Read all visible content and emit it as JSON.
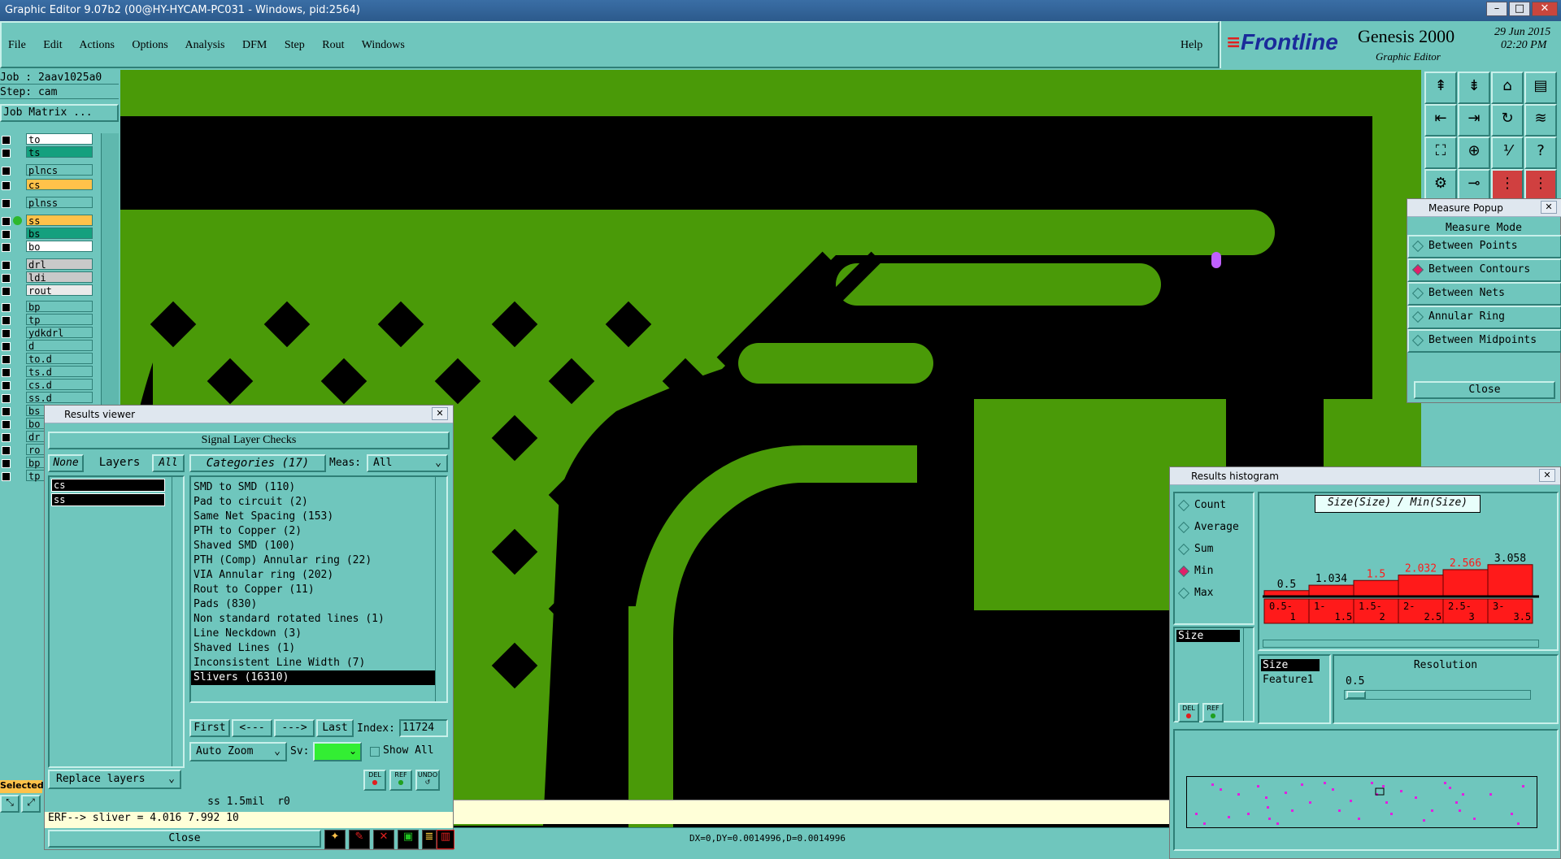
{
  "window": {
    "title": "Graphic Editor 9.07b2 (00@HY-HYCAM-PC031 - Windows, pid:2564)"
  },
  "menu": [
    "File",
    "Edit",
    "Actions",
    "Options",
    "Analysis",
    "DFM",
    "Step",
    "Rout",
    "Windows"
  ],
  "help": "Help",
  "brand": {
    "logo": "Frontline",
    "product": "Genesis 2000",
    "subtitle": "Graphic Editor",
    "date": "29 Jun 2015",
    "time": "02:20 PM"
  },
  "job": {
    "job_label": "Job : 2aav1025a0",
    "step_label": "Step: cam",
    "matrix_button": "Job Matrix ..."
  },
  "layers": [
    {
      "name": "to",
      "color": "#ffffff"
    },
    {
      "name": "ts",
      "color": "#14a07e"
    },
    {
      "name": "plncs",
      "color": "#6fc6bd"
    },
    {
      "name": "cs",
      "color": "#ffc24a"
    },
    {
      "name": "plnss",
      "color": "#6fc6bd"
    },
    {
      "name": "ss",
      "color": "#ffc24a"
    },
    {
      "name": "bs",
      "color": "#14a07e"
    },
    {
      "name": "bo",
      "color": "#ffffff"
    },
    {
      "name": "drl",
      "color": "#c9c9c9"
    },
    {
      "name": "ldi",
      "color": "#c9c9c9"
    },
    {
      "name": "rout",
      "color": "#eaeaea"
    },
    {
      "name": "bp",
      "color": "#6fc6bd"
    },
    {
      "name": "tp",
      "color": "#6fc6bd"
    },
    {
      "name": "ydkdrl",
      "color": "#6fc6bd"
    },
    {
      "name": "d",
      "color": "#6fc6bd"
    },
    {
      "name": "to.d",
      "color": "#6fc6bd"
    },
    {
      "name": "ts.d",
      "color": "#6fc6bd"
    },
    {
      "name": "cs.d",
      "color": "#6fc6bd"
    },
    {
      "name": "ss.d",
      "color": "#6fc6bd"
    },
    {
      "name": "bs",
      "color": "#6fc6bd"
    },
    {
      "name": "bo",
      "color": "#6fc6bd"
    },
    {
      "name": "dr",
      "color": "#6fc6bd"
    },
    {
      "name": "ro",
      "color": "#6fc6bd"
    },
    {
      "name": "bp",
      "color": "#6fc6bd"
    },
    {
      "name": "tp",
      "color": "#6fc6bd"
    }
  ],
  "selected_label": "Selected",
  "results_viewer": {
    "title": "Results viewer",
    "header": "Signal Layer Checks",
    "none": "None",
    "layers": "Layers",
    "all": "All",
    "categories_title": "Categories (17)",
    "meas_label": "Meas:",
    "meas_value": "All",
    "layer_list": [
      "cs",
      "ss"
    ],
    "categories": [
      "SMD to SMD (110)",
      "Pad to circuit (2)",
      "Same Net Spacing (153)",
      "PTH to Copper (2)",
      "Shaved SMD (100)",
      "PTH (Comp) Annular ring (22)",
      "VIA Annular ring (202)",
      "Rout to Copper (11)",
      "Pads (830)",
      "Non standard rotated lines (1)",
      "Line Neckdown (3)",
      "Shaved Lines (1)",
      "Inconsistent Line Width (7)",
      "Slivers (16310)"
    ],
    "nav": {
      "first": "First",
      "prev": "<---",
      "next": "--->",
      "last": "Last",
      "index_label": "Index:",
      "index_value": "11724"
    },
    "auto_zoom": "Auto Zoom",
    "sv_label": "Sv:",
    "show_all": "Show All",
    "replace_layers": "Replace layers",
    "btn_del": "DEL",
    "btn_ref": "REF",
    "btn_undo": "UNDO",
    "status1": "ss 1.5mil  r0",
    "status2": "ERF--> sliver = 4.016 7.992 10",
    "close": "Close"
  },
  "measure_popup": {
    "title": "Measure Popup",
    "mode_title": "Measure Mode",
    "options": [
      {
        "label": "Between Points",
        "selected": false
      },
      {
        "label": "Between Contours",
        "selected": true
      },
      {
        "label": "Between Nets",
        "selected": false
      },
      {
        "label": "Annular Ring",
        "selected": false
      },
      {
        "label": "Between Midpoints",
        "selected": false
      }
    ],
    "close": "Close"
  },
  "histogram": {
    "title": "Results histogram",
    "options": [
      {
        "label": "Count",
        "selected": false
      },
      {
        "label": "Average",
        "selected": false
      },
      {
        "label": "Sum",
        "selected": false
      },
      {
        "label": "Min",
        "selected": true
      },
      {
        "label": "Max",
        "selected": false
      }
    ],
    "left_list": [
      "Size"
    ],
    "chart_title": "Size(Size) / Min(Size)",
    "bins": [
      {
        "range": "0.5-\n1",
        "value": 0.5,
        "label": "0.5",
        "label_color": "#000000"
      },
      {
        "range": "1-\n1.5",
        "value": 1.034,
        "label": "1.034",
        "label_color": "#000000"
      },
      {
        "range": "1.5-\n2",
        "value": 1.5,
        "label": "1.5",
        "label_color": "#ff1a1a"
      },
      {
        "range": "2-\n2.5",
        "value": 2.032,
        "label": "2.032",
        "label_color": "#ff1a1a"
      },
      {
        "range": "2.5-\n3",
        "value": 2.566,
        "label": "2.566",
        "label_color": "#ff1a1a"
      },
      {
        "range": "3-\n3.5",
        "value": 3.058,
        "label": "3.058",
        "label_color": "#000000"
      }
    ],
    "fields": [
      "Size",
      "Feature1"
    ],
    "resolution_label": "Resolution",
    "resolution_value": "0.5",
    "btn_del": "DEL",
    "btn_ref": "REF"
  },
  "statusbar": {
    "coords": "DX=0,DY=0.0014996,D=0.0014996"
  },
  "colors": {
    "board": "#4a9a08",
    "background": "#000000",
    "panel": "#6fc6bd",
    "highlight": "#c060ff"
  }
}
